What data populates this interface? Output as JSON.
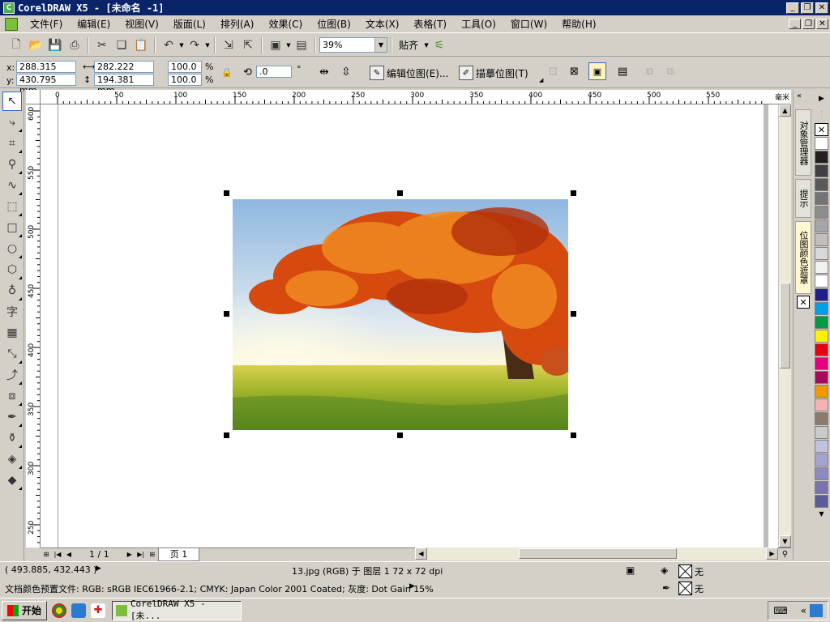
{
  "window": {
    "title": "CorelDRAW X5 - [未命名 -1]",
    "app_icon_letter": "C"
  },
  "menu": [
    "文件(F)",
    "编辑(E)",
    "视图(V)",
    "版面(L)",
    "排列(A)",
    "效果(C)",
    "位图(B)",
    "文本(X)",
    "表格(T)",
    "工具(O)",
    "窗口(W)",
    "帮助(H)"
  ],
  "toolbar": {
    "zoom_value": "39%",
    "snap_label": "贴齐"
  },
  "propbar": {
    "x_label": "x:",
    "y_label": "y:",
    "x_value": "288.315 mm",
    "y_value": "430.795 mm",
    "width_value": "282.222 mm",
    "height_value": "194.381 mm",
    "scale_x": "100.0",
    "scale_y": "100.0",
    "percent": "%",
    "rotation": ".0",
    "degree": "°",
    "edit_bitmap_label": "编辑位图(E)...",
    "trace_bitmap_label": "描摹位图(T)"
  },
  "ruler": {
    "unit": "毫米",
    "h_ticks": [
      "0",
      "50",
      "100",
      "150",
      "200",
      "250",
      "300",
      "350",
      "400",
      "450",
      "500",
      "550"
    ],
    "v_ticks": [
      "600",
      "550",
      "500",
      "450",
      "400",
      "350",
      "300",
      "250"
    ]
  },
  "pagebar": {
    "page_count": "1 / 1",
    "page_tab": "页 1"
  },
  "dockers": {
    "object_manager": "对象管理器",
    "hints": "提示",
    "bitmap_color_mask": "位图颜色遮罩"
  },
  "palette_colors": [
    "#ffffff",
    "#231f20",
    "#404040",
    "#595959",
    "#737373",
    "#8c8c8c",
    "#a6a6a6",
    "#bfbfbf",
    "#d9d9d9",
    "#f2f2f2",
    "#ffffff",
    "#1d2088",
    "#00a0e9",
    "#009944",
    "#fff100",
    "#e60012",
    "#e4007f",
    "#a40b5d",
    "#f39800",
    "#f5b2b2",
    "#8c7b6b",
    "#c9caca",
    "#c3c1e0",
    "#a6a3d3",
    "#8f89c1",
    "#7b72b0",
    "#5a5c9a"
  ],
  "status": {
    "coords": "( 493.885, 432.443 )",
    "object_info": "13.jpg (RGB) 于 图层 1 72 x 72 dpi",
    "color_profile": "文档颜色预置文件: RGB: sRGB IEC61966-2.1; CMYK: Japan Color 2001 Coated; 灰度: Dot Gain 15%",
    "fill_none": "无",
    "outline_none": "无"
  },
  "taskbar": {
    "start_label": "开始",
    "task_label": "CorelDRAW X5 - [未..."
  }
}
